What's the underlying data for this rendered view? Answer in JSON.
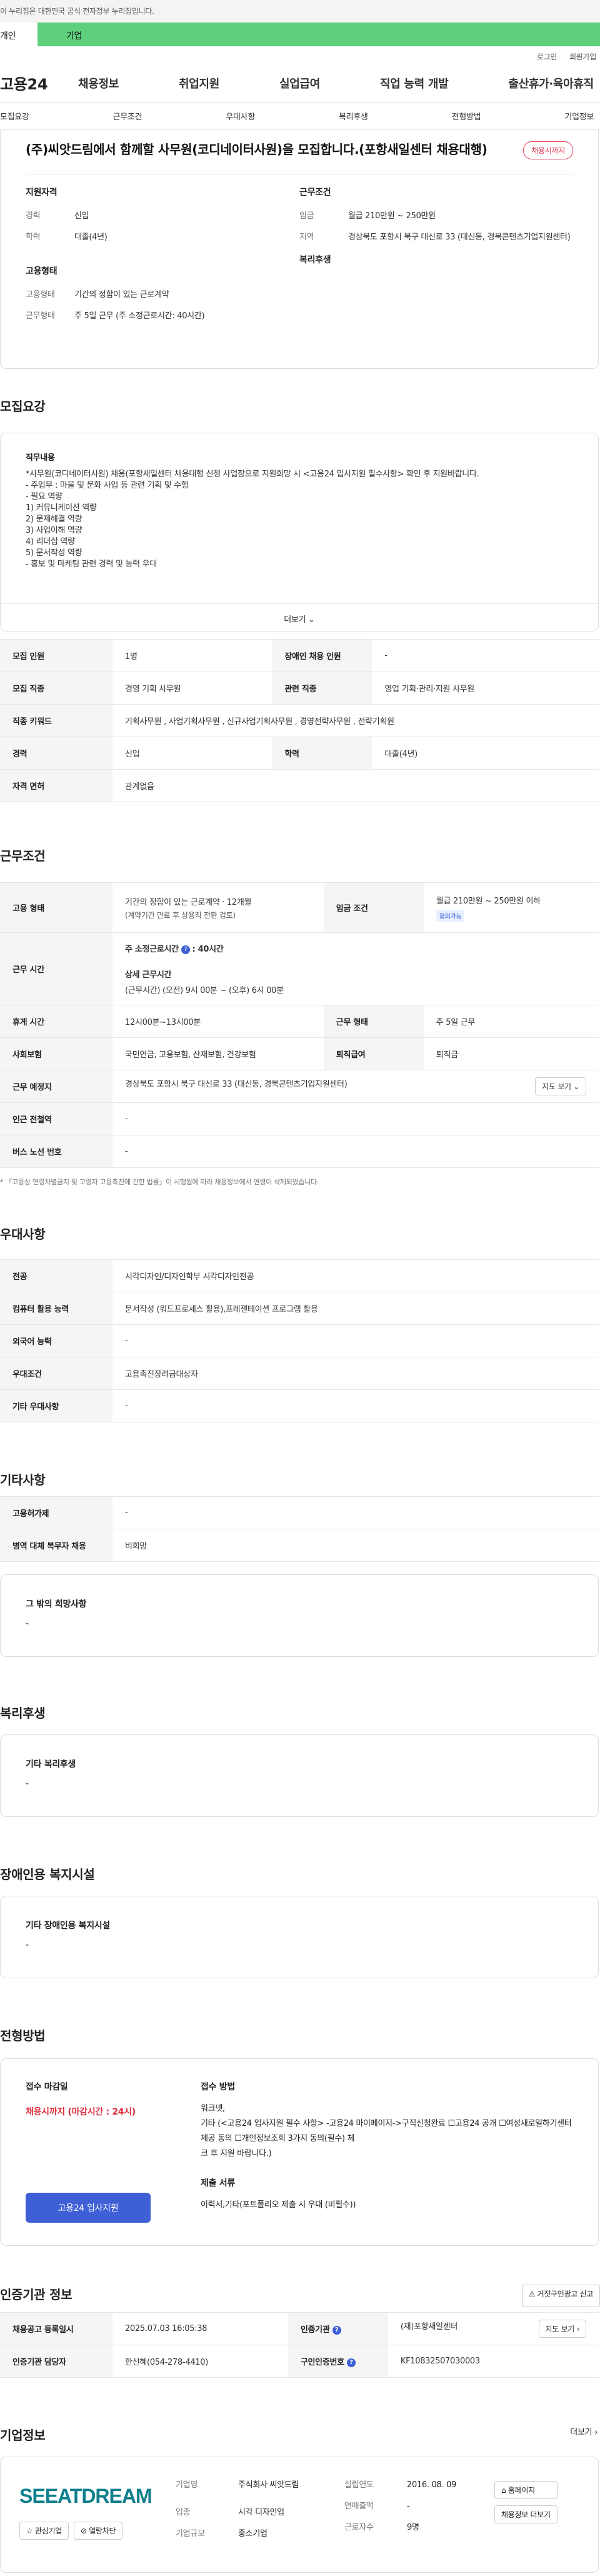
{
  "topbar": {
    "notice": "이 누리집은 대한민국 공식 전자정부 누리집입니다."
  },
  "tabs": [
    "개인",
    "기업"
  ],
  "toplinks": [
    "로그인",
    "회원가입"
  ],
  "gnb": {
    "logo": "고용24",
    "menu": [
      "채용정보",
      "취업지원",
      "실업급여",
      "직업 능력 개발",
      "출산휴가·육아휴직"
    ]
  },
  "subnav": [
    "모집요강",
    "근무조건",
    "우대사항",
    "복리후생",
    "전형방법",
    "기업정보"
  ],
  "head": {
    "title": "(주)씨앗드림에서 함께할 사무원(코디네이터사원)을 모집합니다.(포항새일센터 채용대행)",
    "badge": "채용시까지",
    "qual_label": "지원자격",
    "cond_label": "근무조건",
    "emp_label": "고용형태",
    "welfare_label": "복리후생",
    "career_k": "경력",
    "career_v": "신입",
    "edu_k": "학력",
    "edu_v": "대졸(4년)",
    "wage_k": "임금",
    "wage_v": "월급 210만원 ~ 250만원",
    "area_k": "지역",
    "area_v": "경상북도 포항시 북구 대신로 33 (대신동, 경북콘텐츠기업지원센터)",
    "etype_k": "고용형태",
    "etype_v": "기간의 정함이 있는 근로계약",
    "hours_k": "근무형태",
    "hours_v": "주 5일 근무 (주 소정근로시간: 40시간)"
  },
  "recruit": {
    "title": "모집요강",
    "job_label": "직무내용",
    "lines": [
      "*사무원(코디네이터사원) 채용(포항새일센터 채용대행 신청 사업장으로 지원희망 시 <고용24 입사지원 필수사항> 확인 후 지원바랍니다.",
      "- 주업무 : 마을 및 문화 사업 등 관련 기획 및 수행",
      "- 필요 역량",
      "1) 커뮤니케이션 역량",
      "2) 문제해결 역량",
      "3) 사업이해 역량",
      "4) 리더십 역량",
      "5) 문서작성 역량",
      "- 홍보 및 마케팅 관련 경력 및 능력 우대"
    ],
    "more": "더보기",
    "table": [
      [
        "모집 인원",
        "1명",
        "장애인 채용 인원",
        "-"
      ],
      [
        "모집 직종",
        "경영 기획 사무원",
        "관련 직종",
        "영업 기획·관리·지원 사무원"
      ],
      [
        "직종 키워드",
        "기획사무원 , 사업기획사무원 , 신규사업기획사무원 , 경영전략사무원 , 전략기획원"
      ],
      [
        "경력",
        "신입",
        "학력",
        "대졸(4년)"
      ],
      [
        "자격 면허",
        "관계없음"
      ]
    ]
  },
  "workcond": {
    "title": "근무조건",
    "emp_k": "고용 형태",
    "emp_v": "기간의 정함이 있는 근로계약 · 12개월",
    "emp_v2": "(계약기간 만료 후 상용직 전환 검토)",
    "wage_k": "임금 조건",
    "wage_v": "월급 210만원 ~ 250만원 이하",
    "wage_chip": "협의가능",
    "time_k": "근무 시간",
    "time_a": "주 소정근로시간",
    "time_a_v": ": 40시간",
    "time_b": "상세 근무시간",
    "time_b_v": "(근무시간) (오전) 9시 00분 ~ (오후) 6시 00분",
    "rows": [
      [
        "휴게 시간",
        "12시00분~13시00분",
        "근무 형태",
        "주 5일 근무"
      ],
      [
        "사회보험",
        "국민연금, 고용보험, 산재보험, 건강보험",
        "퇴직급여",
        "퇴직금"
      ]
    ],
    "place_k": "근무 예정지",
    "place_v": "경상북도 포항시 북구 대신로 33 (대신동, 경북콘텐츠기업지원센터)",
    "map": "지도 보기",
    "rows2": [
      [
        "인근 전철역",
        "-"
      ],
      [
        "버스 노선 번호",
        "-"
      ]
    ],
    "note": "* 「고용상 연령차별금지 및 고령자 고용촉진에 관한 법률」이 시행됨에 따라 채용정보에서 연령이 삭제되었습니다."
  },
  "pref": {
    "title": "우대사항",
    "rows": [
      [
        "전공",
        "시각디자인/디자인학부 시각디자인전공"
      ],
      [
        "컴퓨터 활용 능력",
        "문서작성 (워드프로세스 활용),프레젠테이션 프로그램 활용"
      ],
      [
        "외국어 능력",
        "-"
      ],
      [
        "우대조건",
        "고용촉진장려금대상자"
      ],
      [
        "기타 우대사항",
        "-"
      ]
    ]
  },
  "etc": {
    "title": "기타사항",
    "rows": [
      [
        "고용허가제",
        "-"
      ],
      [
        "병역 대체 복무자 채용",
        "비희망"
      ]
    ],
    "hope": "그 밖의 희망사항",
    "hope_v": "-"
  },
  "welfare": {
    "title": "복리후생",
    "cap": "기타 복리후생",
    "v": "-"
  },
  "disab": {
    "title": "장애인용 복지시설",
    "cap": "기타 장애인용 복지시설",
    "v": "-"
  },
  "apply": {
    "title": "전형방법",
    "deadline_k": "접수 마감일",
    "deadline_v": "채용시까지 (마감시간 : 24시)",
    "btn": "고용24 입사지원",
    "method_k": "접수 방법",
    "method_lines": [
      "워크넷,",
      "기타 (<고용24 입사지원 필수 사항> -고용24 마이페이지->구직신청완료   ☐고용24 공개   ☐여성새로일하기센터 제공 동의   ☐개인정보조회   3가지 동의(필수) 체",
      "크 후 지원 바랍니다.)"
    ],
    "docs_k": "제출 서류",
    "docs_v": "이력서,기타(포트폴리오 제출 시 우대 (비필수))"
  },
  "agency": {
    "title": "인증기관 정보",
    "report": "거짓구인광고 신고",
    "rows": [
      [
        "채용공고 등록일시",
        "2025.07.03 16:05:38",
        "인증기관",
        "(재)포항새일센터"
      ],
      [
        "인증기관 담당자",
        "한선혜(054-278-4410)",
        "구인인증번호",
        "KF10832507030003"
      ]
    ],
    "map": "지도 보기"
  },
  "company": {
    "title": "기업정보",
    "more": "더보기",
    "logo": "SEEATDREAM",
    "fav": "관심기업",
    "follow": "열람차단",
    "info": [
      [
        "기업명",
        "주식회사 씨앗드림"
      ],
      [
        "업종",
        "시각 디자인업"
      ],
      [
        "기업규모",
        "중소기업"
      ]
    ],
    "info2": [
      [
        "설립연도",
        "2016. 08. 09"
      ],
      [
        "연매출액",
        "-"
      ],
      [
        "근로자수",
        "9명"
      ]
    ],
    "homepage": "홈페이지",
    "jobs": "채용정보 더보기"
  },
  "colors": {
    "accent": "#3f5fd6",
    "green": "#5ed07d",
    "red": "#e02d3c"
  }
}
